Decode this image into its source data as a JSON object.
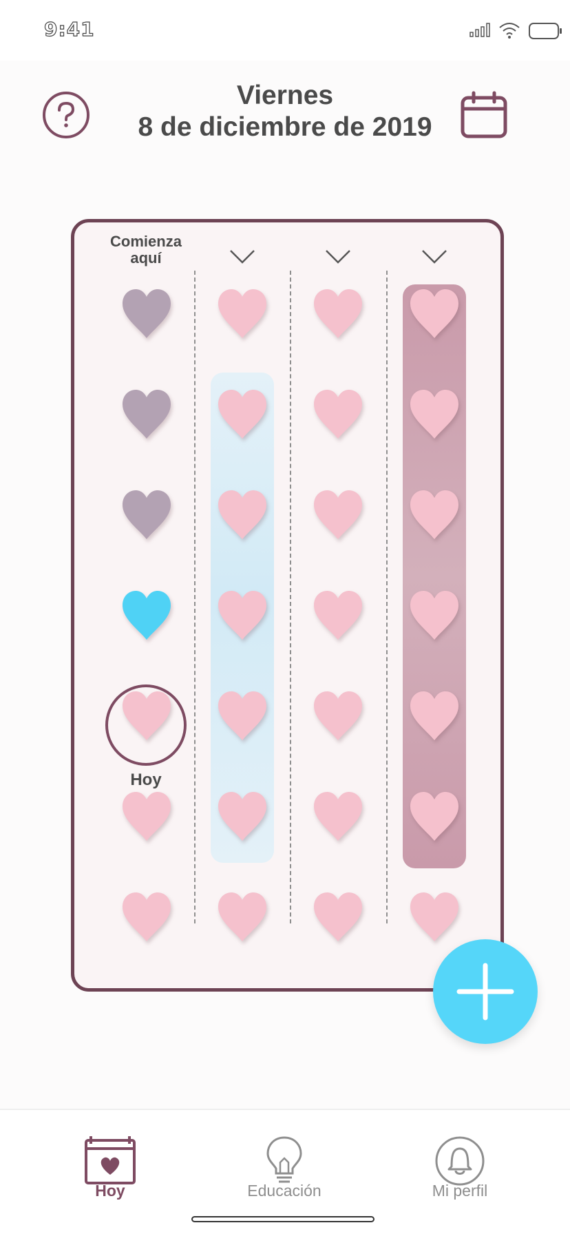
{
  "status_bar": {
    "time": "9:41"
  },
  "header": {
    "weekday": "Viernes",
    "date": "8 de diciembre de 2019",
    "help_icon": "question-circle-icon",
    "calendar_icon": "calendar-icon"
  },
  "grid": {
    "start_label": "Comienza aquí",
    "today_label": "Hoy",
    "columns": [
      {
        "type": "start",
        "hearts": [
          "gray",
          "gray",
          "gray",
          "blue",
          "pink",
          "pink",
          "pink"
        ]
      },
      {
        "type": "expand",
        "hearts": [
          "pink",
          "pink",
          "pink",
          "pink",
          "pink",
          "pink",
          "pink"
        ]
      },
      {
        "type": "expand",
        "hearts": [
          "pink",
          "pink",
          "pink",
          "pink",
          "pink",
          "pink",
          "pink"
        ]
      },
      {
        "type": "expand",
        "hearts": [
          "pink",
          "pink",
          "pink",
          "pink",
          "pink",
          "pink",
          "pink"
        ]
      }
    ],
    "colors": {
      "gray": "#b3a2b3",
      "blue": "#4fd2f5",
      "pink": "#f5c1cd",
      "accent": "#7e4b62",
      "band_blue": "#d9edf7",
      "band_plum": "#cda2b2"
    }
  },
  "fab": {
    "icon": "plus-icon",
    "color": "#55d6f9"
  },
  "tabs": [
    {
      "label": "Hoy",
      "icon": "calendar-heart-icon",
      "active": true
    },
    {
      "label": "Educación",
      "icon": "lightbulb-icon",
      "active": false
    },
    {
      "label": "Mi perfil",
      "icon": "profile-icon",
      "active": false
    }
  ]
}
